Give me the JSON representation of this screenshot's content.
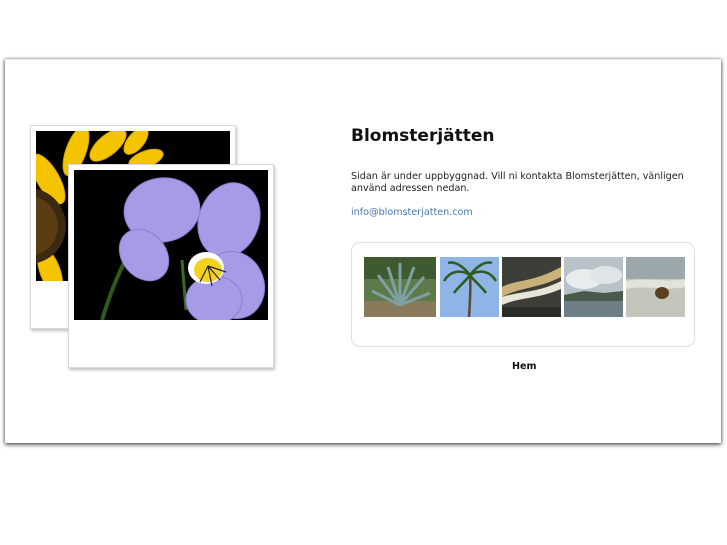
{
  "page": {
    "title": "Blomsterjätten",
    "intro": "Sidan är under uppbyggnad. Vill ni kontakta Blomsterjätten, vänligen använd adressen nedan.",
    "email": "info@blomsterjatten.com"
  },
  "photos": [
    {
      "name": "sunflower-photo"
    },
    {
      "name": "violet-photo"
    }
  ],
  "gallery": {
    "thumbnails": [
      {
        "name": "agave-thumbnail"
      },
      {
        "name": "palm-thumbnail"
      },
      {
        "name": "wave-thumbnail"
      },
      {
        "name": "coast-thumbnail"
      },
      {
        "name": "coconut-beach-thumbnail"
      }
    ]
  },
  "nav": {
    "home_label": "Hem"
  },
  "colors": {
    "link": "#4a7bb0",
    "text": "#222222",
    "background": "#ffffff"
  }
}
